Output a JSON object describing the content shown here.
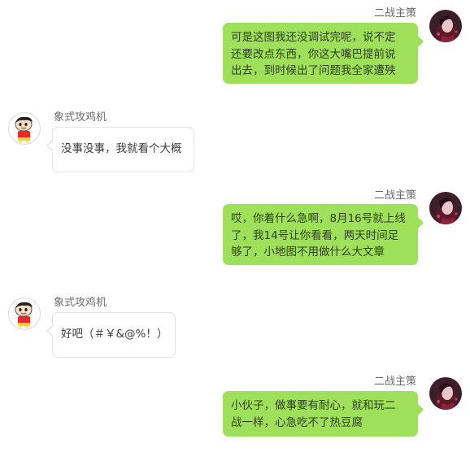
{
  "messages": [
    {
      "sender": "二战主策",
      "lines": [
        "可是这图我还没调试完呢，说不定",
        "还要改点东西，你这大嘴巴提前说",
        "出去，到时候出了问题我全家遭殃"
      ]
    },
    {
      "sender": "象式攻鸡机",
      "lines": [
        "没事没事，我就看个大概"
      ]
    },
    {
      "sender": "二战主策",
      "lines": [
        "哎，你着什么急啊，8月16号就上线",
        "了，我14号让你看看，两天时间足",
        "够了，小地图不用做什么大文章"
      ]
    },
    {
      "sender": "象式攻鸡机",
      "lines": [
        "好吧（＃￥&@%！）"
      ]
    },
    {
      "sender": "二战主策",
      "lines": [
        "小伙子，做事要有耐心，就和玩二",
        "战一样，心急吃不了热豆腐"
      ]
    }
  ],
  "colors": {
    "sent_bubble": "#9fe05a",
    "recv_bubble": "#ffffff",
    "recv_border": "#e3e3e3",
    "name_text": "#6b6b6b"
  },
  "icons": {
    "sent_avatar": "anime-girl-avatar",
    "recv_avatar": "cartoon-boy-avatar"
  }
}
